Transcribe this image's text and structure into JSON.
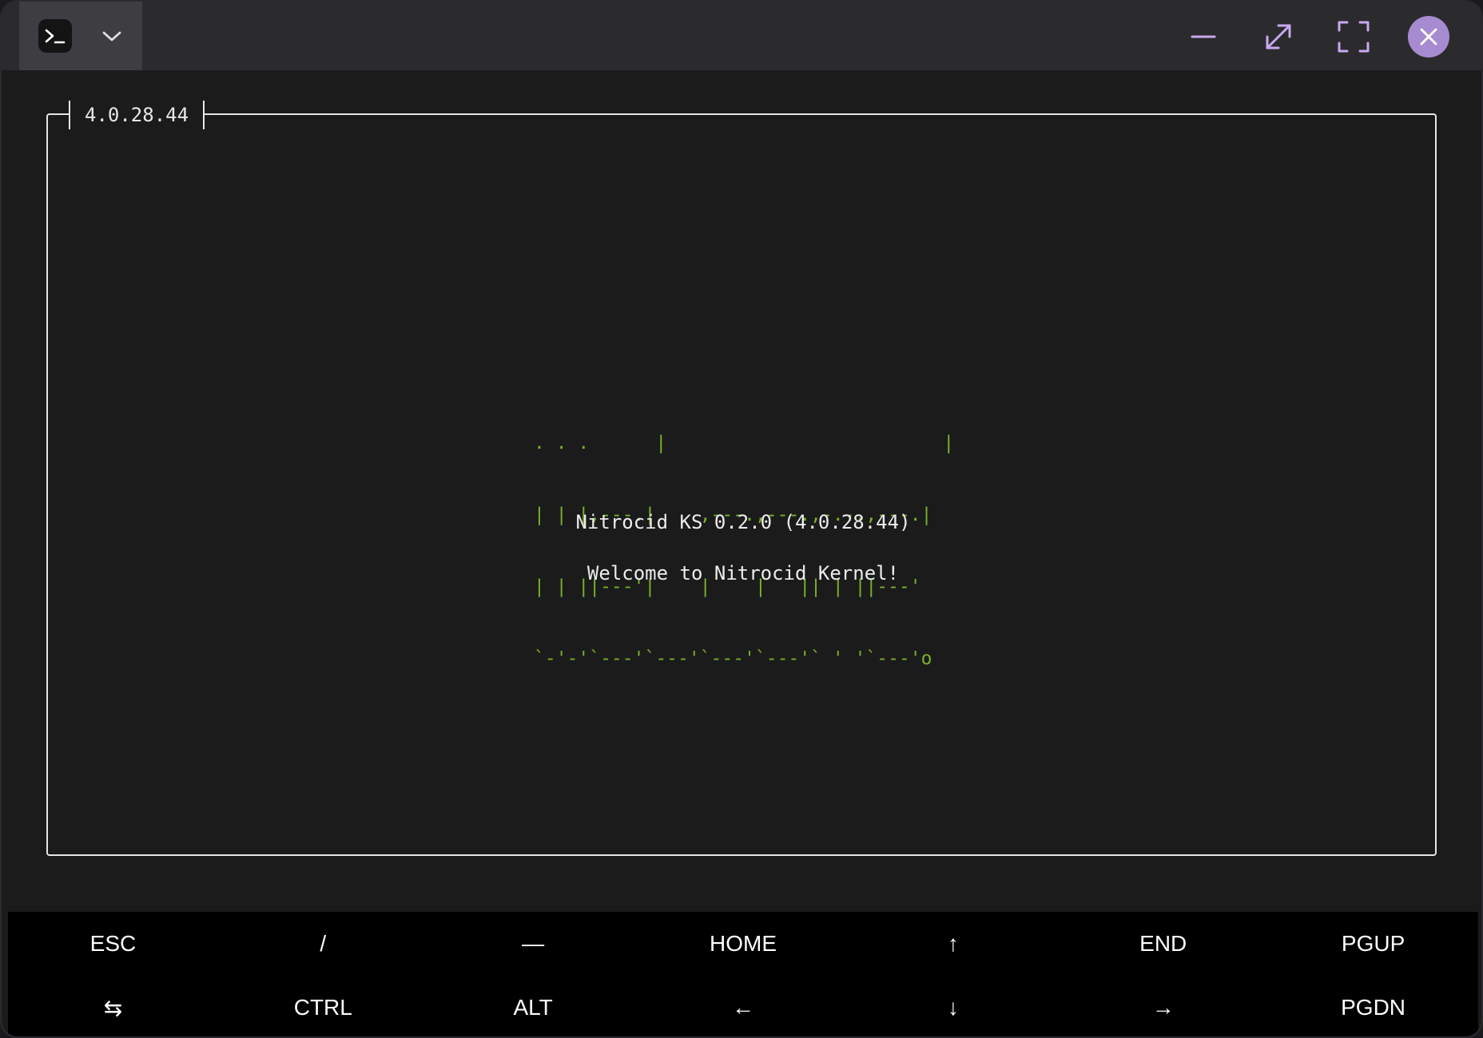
{
  "titlebar": {
    "icons": {
      "terminal": "terminal-prompt-icon",
      "chevron": "chevron-down-icon",
      "minimize": "minimize-icon",
      "expand": "expand-icon",
      "fullscreen": "fullscreen-icon",
      "close": "close-icon"
    },
    "accent_color": "#a78bd0"
  },
  "terminal": {
    "frame_title": "4.0.28.44",
    "ascii_art": [
      ". . .      |                         |",
      "| | |,---.|    ,---.,---.,-.-.,---.|",
      "| | ||---'|    |    |   || | ||---'",
      "`-'-'`---'`---'`---'`---'` ' '`---'o"
    ],
    "ascii_color": "#7ab02c",
    "version_line": "Nitrocid KS 0.2.0 (4.0.28.44)",
    "welcome_line": "Welcome to Nitrocid Kernel!"
  },
  "extra_keys": {
    "row1": [
      "ESC",
      "/",
      "—",
      "HOME",
      "↑",
      "END",
      "PGUP"
    ],
    "row2": [
      "⇆",
      "CTRL",
      "ALT",
      "←",
      "↓",
      "→",
      "PGDN"
    ]
  }
}
